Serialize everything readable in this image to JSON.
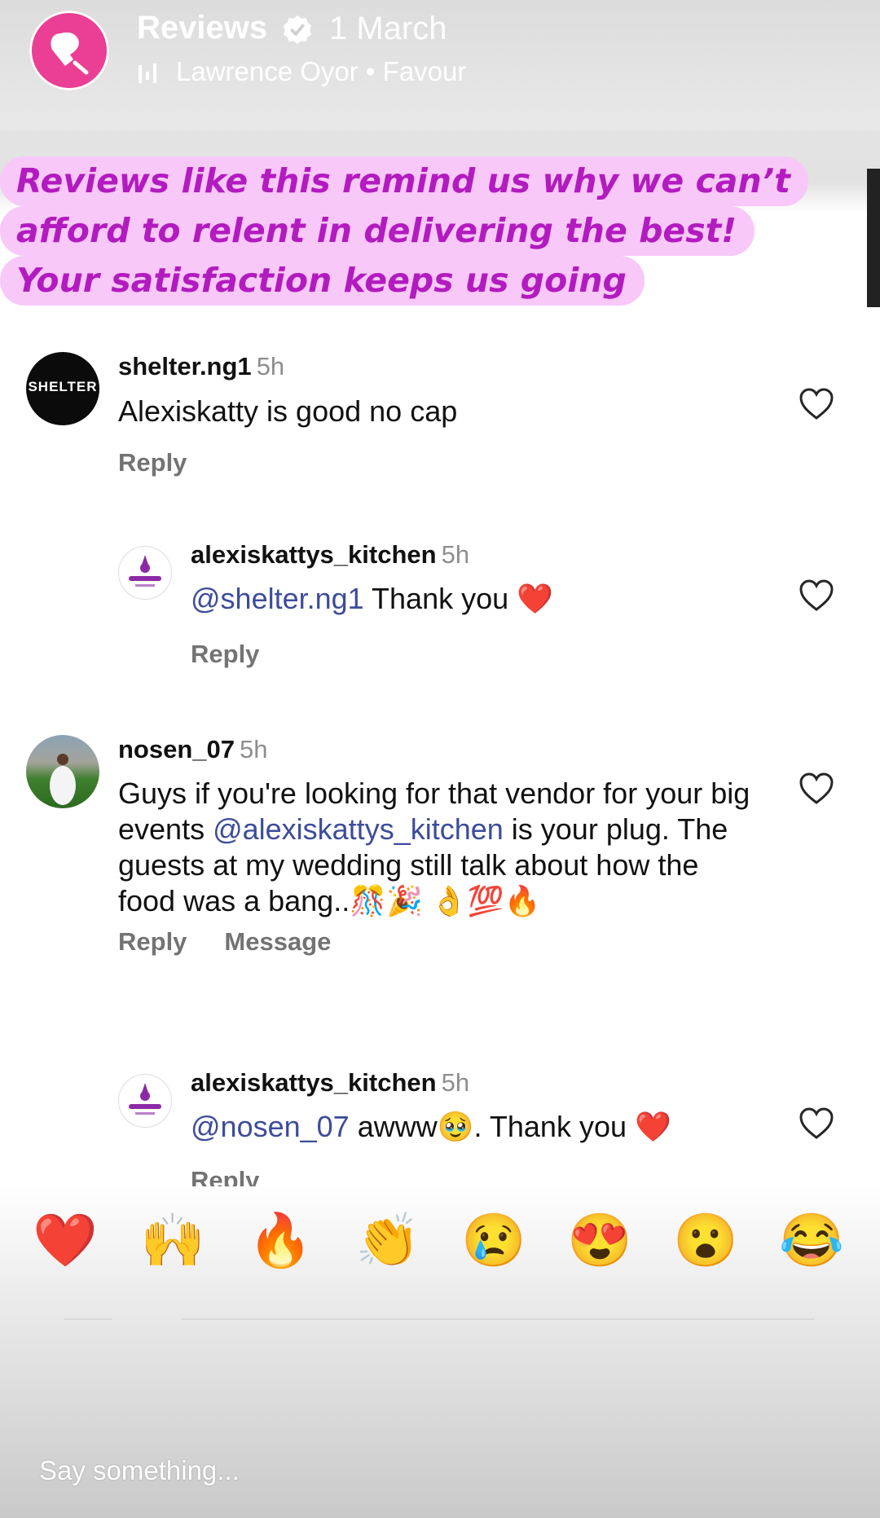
{
  "story": {
    "account_name": "Reviews",
    "time": "1 March",
    "music": "Lawrence Oyor • Favour",
    "colors": {
      "avatar": "#ea3f94",
      "caption_bg": "#f8c8f8",
      "caption_text": "#b21bbf"
    }
  },
  "caption": {
    "lines": [
      "Reviews like this remind us why we can’t",
      "afford to relent in delivering the best!",
      "Your satisfaction keeps us going"
    ]
  },
  "comments": [
    {
      "username": "shelter.ng1",
      "time": "5h",
      "text": "Alexiskatty is good no cap",
      "avatar_label": "SHELTER",
      "reply": "Reply"
    },
    {
      "username": "alexiskattys_kitchen",
      "time": "5h",
      "mention": "@shelter.ng1",
      "text": " Thank you ❤️",
      "reply": "Reply"
    },
    {
      "username": "nosen_07",
      "time": "5h",
      "text_before": "Guys if you're looking for that vendor for your big events ",
      "mention": "@alexiskattys_kitchen",
      "text_after": " is your plug. The guests at my wedding still talk about how the food was a bang..🎊🎉 👌💯🔥",
      "reply": "Reply",
      "message": "Message"
    },
    {
      "username": "alexiskattys_kitchen",
      "time": "5h",
      "mention": "@nosen_07",
      "text": " awww🥹. Thank you ❤️",
      "reply": "Reply"
    }
  ],
  "reactions": [
    "❤️",
    "🙌",
    "🔥",
    "👏",
    "😢",
    "😍",
    "😮",
    "😂"
  ],
  "input": {
    "placeholder": "Say something..."
  },
  "icons": {
    "story_avatar": "oven-mitt-icon",
    "verified": "verified-badge-icon",
    "music": "music-bars-icon",
    "like": "heart-outline-icon"
  }
}
